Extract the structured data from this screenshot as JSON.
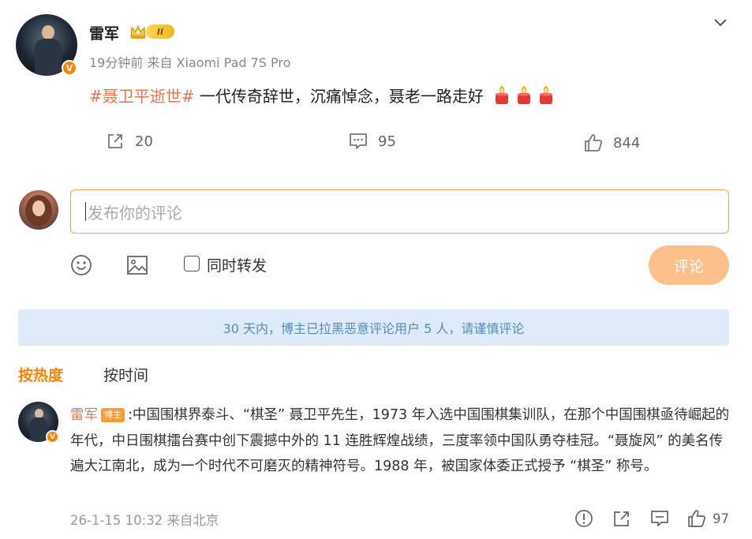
{
  "post": {
    "author_name": "雷军",
    "level_badge": "II",
    "meta": "19分钟前 来自 Xiaomi Pad 7S Pro",
    "hashtag": "#聂卫平逝世#",
    "text": " 一代传奇辞世，沉痛悼念，聂老一路走好",
    "repost_count": "20",
    "comment_count": "95",
    "like_count": "844"
  },
  "compose": {
    "placeholder": "发布你的评论",
    "repost_label": "同时转发",
    "submit_label": "评论"
  },
  "notice": "30 天内，博主已拉黑恶意评论用户 5 人，请谨慎评论",
  "sort": {
    "hot": "按热度",
    "time": "按时间"
  },
  "comment": {
    "author": "雷军",
    "author_badge": "博主",
    "text": ":中国围棋界泰斗、“棋圣” 聂卫平先生，1973 年入选中国围棋集训队，在那个中国围棋亟待崛起的年代，中日围棋擂台赛中创下震撼中外的 11 连胜辉煌战绩，三度率领中国队勇夺桂冠。“聂旋风” 的美名传遍大江南北，成为一个时代不可磨灭的精神符号。1988 年，被国家体委正式授予 “棋圣” 称号。",
    "meta": "26-1-15 10:32 来自北京",
    "like_count": "97"
  },
  "colors": {
    "accent": "#ff8200",
    "link": "#eb7350",
    "notice_bg": "#dcebf7",
    "submit_bg": "#fdc08a"
  },
  "icons": [
    "verified-v-icon",
    "crown-icon",
    "chevron-down-icon",
    "candle-icon",
    "repost-icon",
    "comment-icon",
    "like-icon",
    "emoji-icon",
    "image-icon",
    "report-icon"
  ]
}
